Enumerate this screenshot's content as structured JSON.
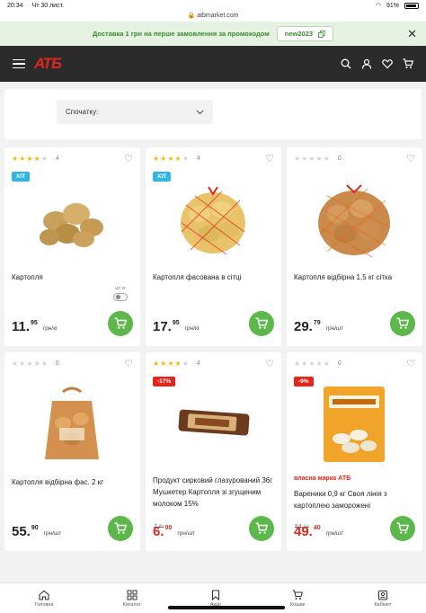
{
  "status_bar": {
    "time": "20:34",
    "date": "Чт 30 лист.",
    "battery": "91%"
  },
  "browser": {
    "url": "atbmarket.com"
  },
  "promo": {
    "text": "Доставка 1 грн на перше замовлення за промокодом",
    "code": "new2023"
  },
  "header": {
    "logo": "АТБ"
  },
  "sort": {
    "label": "Спочатку:"
  },
  "colors": {
    "brand_red": "#e1261c",
    "green": "#5cb84a",
    "header_bg": "#2b2b2b",
    "hit_badge": "#2fb5e6"
  },
  "products": [
    {
      "name": "Картопля",
      "rating": 4,
      "reviews": "4",
      "badge": "ХІТ",
      "price_main": "11.",
      "price_cents": "95",
      "unit": "грн/кг",
      "toggle_left": "шт",
      "toggle_right": "кг",
      "image": "potatoes-loose"
    },
    {
      "name": "Картопля фасована в сітці",
      "rating": 4,
      "reviews": "4",
      "badge": "ХІТ",
      "price_main": "17.",
      "price_cents": "95",
      "unit": "грн/кг",
      "image": "potatoes-net-bag"
    },
    {
      "name": "Картопля відбірна 1,5 кг сітка",
      "rating": 0,
      "reviews": "0",
      "price_main": "29.",
      "price_cents": "79",
      "unit": "грн/шт",
      "image": "potatoes-net-bag-large"
    },
    {
      "name": "Картопля відбірна фас. 2 кг",
      "rating": 0,
      "reviews": "0",
      "price_main": "55.",
      "price_cents": "90",
      "unit": "грн/шт",
      "image": "potatoes-paper-bag"
    },
    {
      "name": "Продукт сирковий глазурований 36г Мушкетер Картопля зі згущеним молоком 15%",
      "rating": 4,
      "reviews": "4",
      "badge": "-17%",
      "price_old": "7.²⁹",
      "price_main": "6.",
      "price_cents": "00",
      "unit": "грн/шт",
      "image": "cheese-bar"
    },
    {
      "name": "Вареники 0,9 кг Своя лінія з картоплею заморожені",
      "private_label": "власна марка АТБ",
      "rating": 0,
      "reviews": "0",
      "badge": "-9%",
      "price_old": "54.⁹⁹",
      "price_main": "49.",
      "price_cents": "40",
      "unit": "грн/шт",
      "image": "dumplings-pack"
    }
  ],
  "bottom_nav": [
    {
      "label": "Головна",
      "icon": "home-icon"
    },
    {
      "label": "Каталог",
      "icon": "catalog-icon"
    },
    {
      "label": "Акції",
      "icon": "bookmark-icon"
    },
    {
      "label": "Кошик",
      "icon": "cart-icon"
    },
    {
      "label": "Кабінет",
      "icon": "profile-icon"
    }
  ]
}
